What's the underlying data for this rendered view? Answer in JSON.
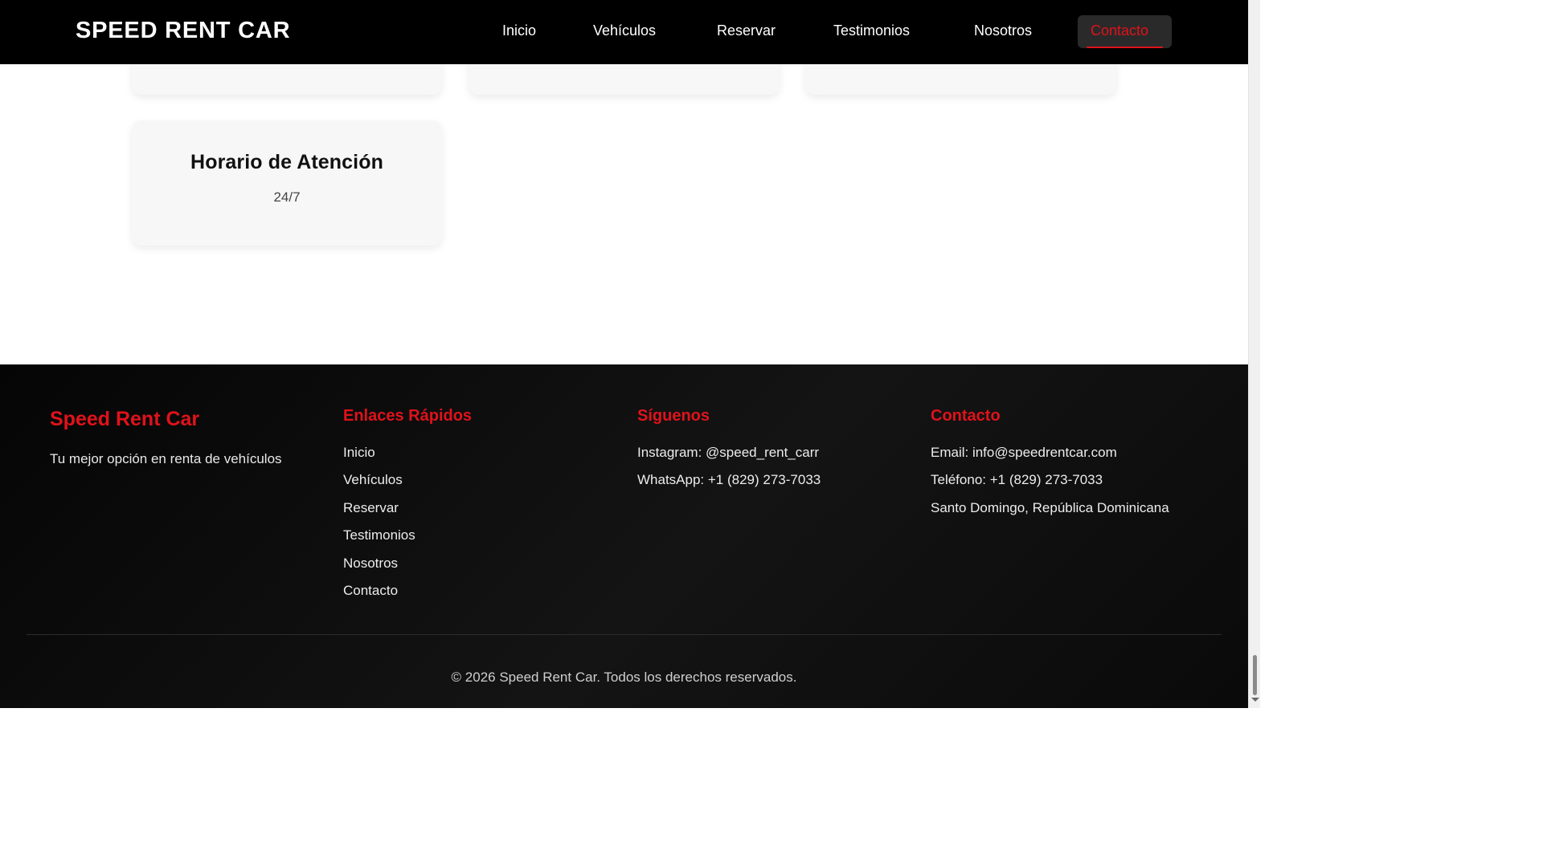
{
  "navbar": {
    "brand": "SPEED RENT CAR",
    "items": [
      {
        "label": "Inicio"
      },
      {
        "label": "Vehículos"
      },
      {
        "label": "Reservar"
      },
      {
        "label": "Testimonios"
      },
      {
        "label": "Nosotros"
      },
      {
        "label": "Contacto",
        "active": true
      }
    ]
  },
  "cards": [
    {
      "title": "Horario de Atención",
      "text": "24/7"
    }
  ],
  "footer": {
    "brand": "Speed Rent Car",
    "tagline": "Tu mejor opción en renta de vehículos",
    "quick_links": {
      "heading": "Enlaces Rápidos",
      "items": [
        "Inicio",
        "Vehículos",
        "Reservar",
        "Testimonios",
        "Nosotros",
        "Contacto"
      ]
    },
    "social": {
      "heading": "Síguenos",
      "items": [
        "Instagram: @speed_rent_carr",
        "WhatsApp: +1 (829) 273-7033"
      ]
    },
    "contact": {
      "heading": "Contacto",
      "items": [
        "Email: info@speedrentcar.com",
        "Teléfono: +1 (829) 273-7033",
        "Santo Domingo, República Dominicana"
      ]
    },
    "copyright": "© 2026 Speed Rent Car. Todos los derechos reservados."
  },
  "colors": {
    "accent": "#e0121a",
    "navbar_bg": "#000000",
    "footer_bg": "#0d0d0d",
    "card_bg": "#f7f7f7"
  }
}
